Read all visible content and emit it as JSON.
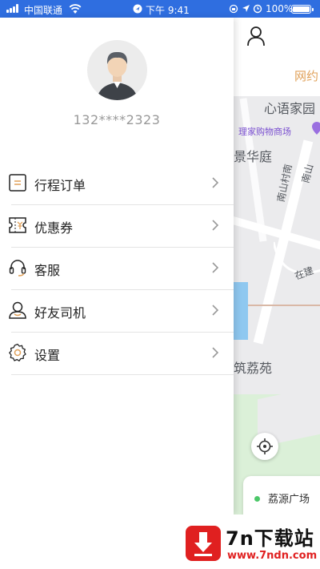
{
  "status_bar": {
    "carrier": "中国联通",
    "time": "下午 9:41",
    "battery": "100%",
    "battery_level": 1.0
  },
  "drawer": {
    "phone": "132****2323",
    "menu": [
      {
        "label": "行程订单",
        "icon": "order-list-icon"
      },
      {
        "label": "优惠券",
        "icon": "coupon-icon"
      },
      {
        "label": "客服",
        "icon": "headset-icon"
      },
      {
        "label": "好友司机",
        "icon": "driver-icon"
      },
      {
        "label": "设置",
        "icon": "gear-icon"
      }
    ]
  },
  "map": {
    "tab_label": "网约",
    "labels": [
      "心语家园",
      "理家购物商场",
      "景华庭",
      "南山",
      "南山村南",
      "在建",
      "筑荔苑"
    ],
    "location_card": {
      "text": "荔源广场"
    }
  },
  "watermark": {
    "title": "7n下载站",
    "url": "www.7ndn.com"
  },
  "colors": {
    "status_bar": "#2f6ee0",
    "accent_orange": "#e0a15a",
    "green_dot": "#4cc769",
    "watermark_red": "#e02020"
  }
}
